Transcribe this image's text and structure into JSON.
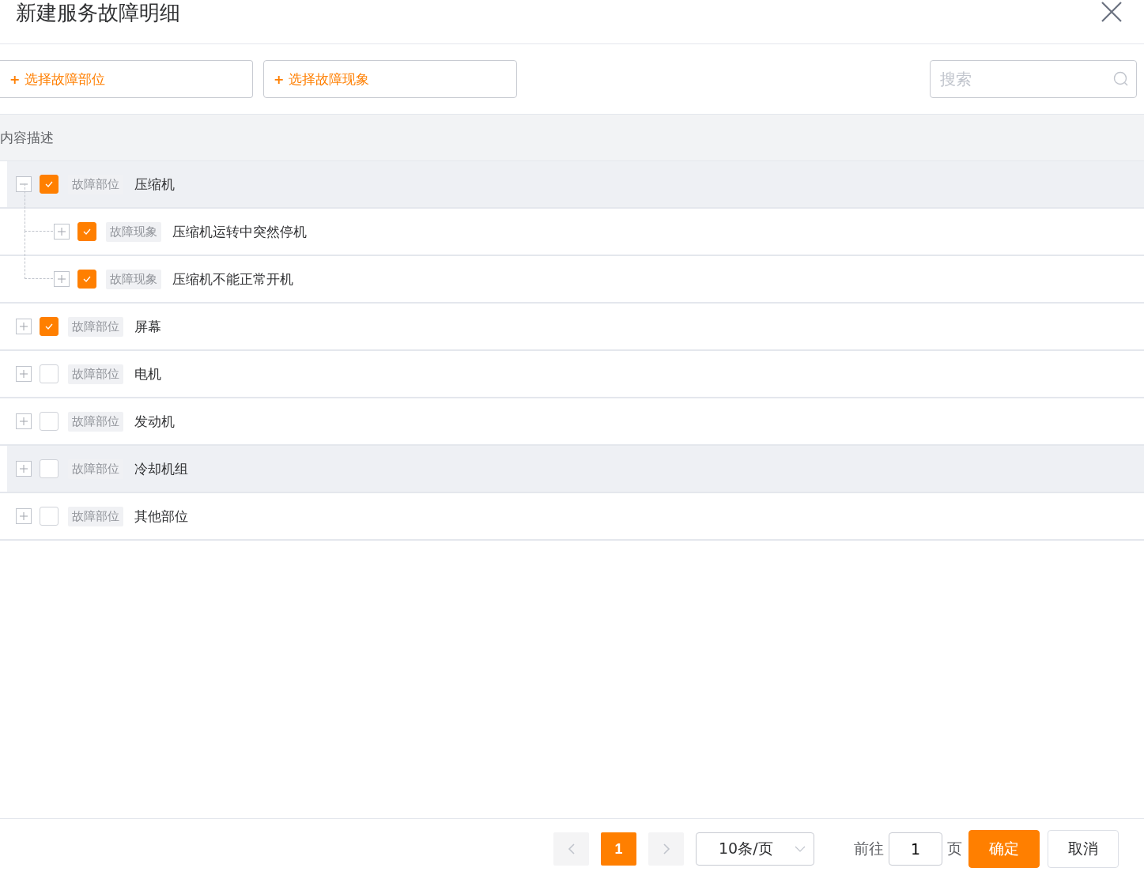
{
  "dialog": {
    "title": "新建服务故障明细"
  },
  "toolbar": {
    "buttons": [
      {
        "icon": "+",
        "label": "选择故障部位"
      },
      {
        "icon": "+",
        "label": "选择故障现象"
      }
    ],
    "search": {
      "placeholder": "搜索"
    }
  },
  "table": {
    "columns": [
      "内容描述"
    ],
    "rows": [
      {
        "tag": "故障部位",
        "name": "压缩机",
        "checked": true,
        "expanded": true,
        "highlighted": true,
        "children": [
          {
            "tag": "故障现象",
            "name": "压缩机运转中突然停机",
            "checked": true,
            "expanded": false,
            "highlighted": false
          },
          {
            "tag": "故障现象",
            "name": "压缩机不能正常开机",
            "checked": true,
            "expanded": false,
            "highlighted": false
          }
        ]
      },
      {
        "tag": "故障部位",
        "name": "屏幕",
        "checked": true,
        "expanded": false,
        "highlighted": false
      },
      {
        "tag": "故障部位",
        "name": "电机",
        "checked": false,
        "expanded": false,
        "highlighted": false
      },
      {
        "tag": "故障部位",
        "name": "发动机",
        "checked": false,
        "expanded": false,
        "highlighted": false
      },
      {
        "tag": "故障部位",
        "name": "冷却机组",
        "checked": false,
        "expanded": false,
        "highlighted": true
      },
      {
        "tag": "故障部位",
        "name": "其他部位",
        "checked": false,
        "expanded": false,
        "highlighted": false
      }
    ]
  },
  "footer": {
    "pagination": {
      "pages": [
        {
          "label": "1",
          "selected": true
        }
      ],
      "page_size": "10条/页",
      "goto_label": "前往",
      "goto_value": "1",
      "goto_suffix": "页"
    },
    "buttons": [
      {
        "label": "确定",
        "kind": "primary"
      },
      {
        "label": "取消",
        "kind": "default"
      }
    ]
  }
}
